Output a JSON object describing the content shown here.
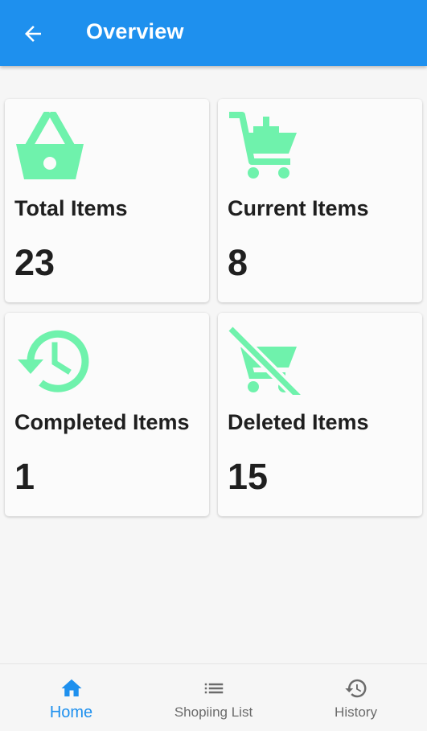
{
  "appbar": {
    "title": "Overview",
    "back_icon": "arrow-left-icon"
  },
  "colors": {
    "primary": "#1e90ee",
    "accent": "#6ff2ac",
    "text": "#1f1f1f"
  },
  "cards": [
    {
      "icon": "basket-icon",
      "label": "Total Items",
      "value": "23"
    },
    {
      "icon": "cart-plus-icon",
      "label": "Current Items",
      "value": "8"
    },
    {
      "icon": "history-icon",
      "label": "Completed Items",
      "value": "1"
    },
    {
      "icon": "cart-off-icon",
      "label": "Deleted Items",
      "value": "15"
    }
  ],
  "bottom_nav": [
    {
      "icon": "home-icon",
      "label": "Home",
      "active": true
    },
    {
      "icon": "list-icon",
      "label": "Shopiing List",
      "active": false
    },
    {
      "icon": "history-icon",
      "label": "History",
      "active": false
    }
  ]
}
